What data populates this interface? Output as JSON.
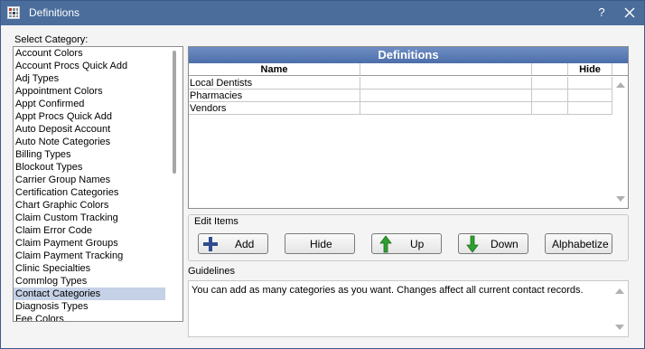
{
  "window": {
    "title": "Definitions",
    "help_label": "?",
    "app_icon": "grid-app-icon",
    "close_icon": "close-icon"
  },
  "category_label": "Select Category:",
  "categories": [
    "Account Colors",
    "Account Procs Quick Add",
    "Adj Types",
    "Appointment Colors",
    "Appt Confirmed",
    "Appt Procs Quick Add",
    "Auto Deposit Account",
    "Auto Note Categories",
    "Billing Types",
    "Blockout Types",
    "Carrier Group Names",
    "Certification Categories",
    "Chart Graphic Colors",
    "Claim Custom Tracking",
    "Claim Error Code",
    "Claim Payment Groups",
    "Claim Payment Tracking",
    "Clinic Specialties",
    "Commlog Types",
    "Contact Categories",
    "Diagnosis Types",
    "Fee Colors"
  ],
  "selected_category": "Contact Categories",
  "definitions": {
    "header": "Definitions",
    "columns": {
      "name": "Name",
      "col2": "",
      "col3": "",
      "hide": "Hide"
    },
    "rows": [
      {
        "name": "Local Dentists",
        "c2": "",
        "c3": "",
        "hide": ""
      },
      {
        "name": "Pharmacies",
        "c2": "",
        "c3": "",
        "hide": ""
      },
      {
        "name": "Vendors",
        "c2": "",
        "c3": "",
        "hide": ""
      }
    ]
  },
  "edit_items": {
    "label": "Edit Items",
    "add": "Add",
    "hide": "Hide",
    "up": "Up",
    "down": "Down",
    "alphabetize": "Alphabetize",
    "icons": {
      "add": "plus-icon",
      "up": "green-up-arrow-icon",
      "down": "green-down-arrow-icon"
    },
    "colors": {
      "plus": "#2e4d8f",
      "arrow": "#2ea02e"
    }
  },
  "guidelines": {
    "label": "Guidelines",
    "text": "You can add as many categories as you want.  Changes affect all current contact records."
  },
  "colors": {
    "titlebar": "#4a6d9c",
    "grid_header": "#5a7cb6",
    "selection": "#c5d1e6"
  }
}
